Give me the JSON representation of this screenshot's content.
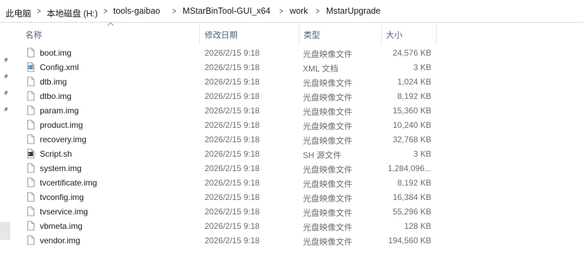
{
  "breadcrumb": [
    "此电脑",
    "本地磁盘 (H:)",
    "tools-gaibao",
    "MStarBinTool-GUI_x64",
    "work",
    "MstarUpgrade"
  ],
  "columns": {
    "name": "名称",
    "date": "修改日期",
    "type": "类型",
    "size": "大小"
  },
  "sort": {
    "column": "name",
    "direction": "ascending"
  },
  "files": [
    {
      "name": "boot.img",
      "date": "2026/2/15 9:18",
      "type": "光盘映像文件",
      "size": "24,576 KB",
      "icon": "file-icon"
    },
    {
      "name": "Config.xml",
      "date": "2026/2/15 9:18",
      "type": "XML 文档",
      "size": "3 KB",
      "icon": "xml-file-icon"
    },
    {
      "name": "dtb.img",
      "date": "2026/2/15 9:18",
      "type": "光盘映像文件",
      "size": "1,024 KB",
      "icon": "file-icon"
    },
    {
      "name": "dtbo.img",
      "date": "2026/2/15 9:18",
      "type": "光盘映像文件",
      "size": "8,192 KB",
      "icon": "file-icon"
    },
    {
      "name": "param.img",
      "date": "2026/2/15 9:18",
      "type": "光盘映像文件",
      "size": "15,360 KB",
      "icon": "file-icon"
    },
    {
      "name": "product.img",
      "date": "2026/2/15 9:18",
      "type": "光盘映像文件",
      "size": "10,240 KB",
      "icon": "file-icon"
    },
    {
      "name": "recovery.img",
      "date": "2026/2/15 9:18",
      "type": "光盘映像文件",
      "size": "32,768 KB",
      "icon": "file-icon"
    },
    {
      "name": "Script.sh",
      "date": "2026/2/15 9:18",
      "type": "SH 源文件",
      "size": "3 KB",
      "icon": "script-file-icon"
    },
    {
      "name": "system.img",
      "date": "2026/2/15 9:18",
      "type": "光盘映像文件",
      "size": "1,284,096...",
      "icon": "file-icon"
    },
    {
      "name": "tvcertificate.img",
      "date": "2026/2/15 9:18",
      "type": "光盘映像文件",
      "size": "8,192 KB",
      "icon": "file-icon"
    },
    {
      "name": "tvconfig.img",
      "date": "2026/2/15 9:18",
      "type": "光盘映像文件",
      "size": "16,384 KB",
      "icon": "file-icon"
    },
    {
      "name": "tvservice.img",
      "date": "2026/2/15 9:18",
      "type": "光盘映像文件",
      "size": "55,296 KB",
      "icon": "file-icon"
    },
    {
      "name": "vbmeta.img",
      "date": "2026/2/15 9:18",
      "type": "光盘映像文件",
      "size": "128 KB",
      "icon": "file-icon"
    },
    {
      "name": "vendor.img",
      "date": "2026/2/15 9:18",
      "type": "光盘映像文件",
      "size": "194,560 KB",
      "icon": "file-icon"
    }
  ],
  "pins": [
    "pin-icon",
    "pin-icon",
    "pin-icon",
    "pin-icon"
  ]
}
